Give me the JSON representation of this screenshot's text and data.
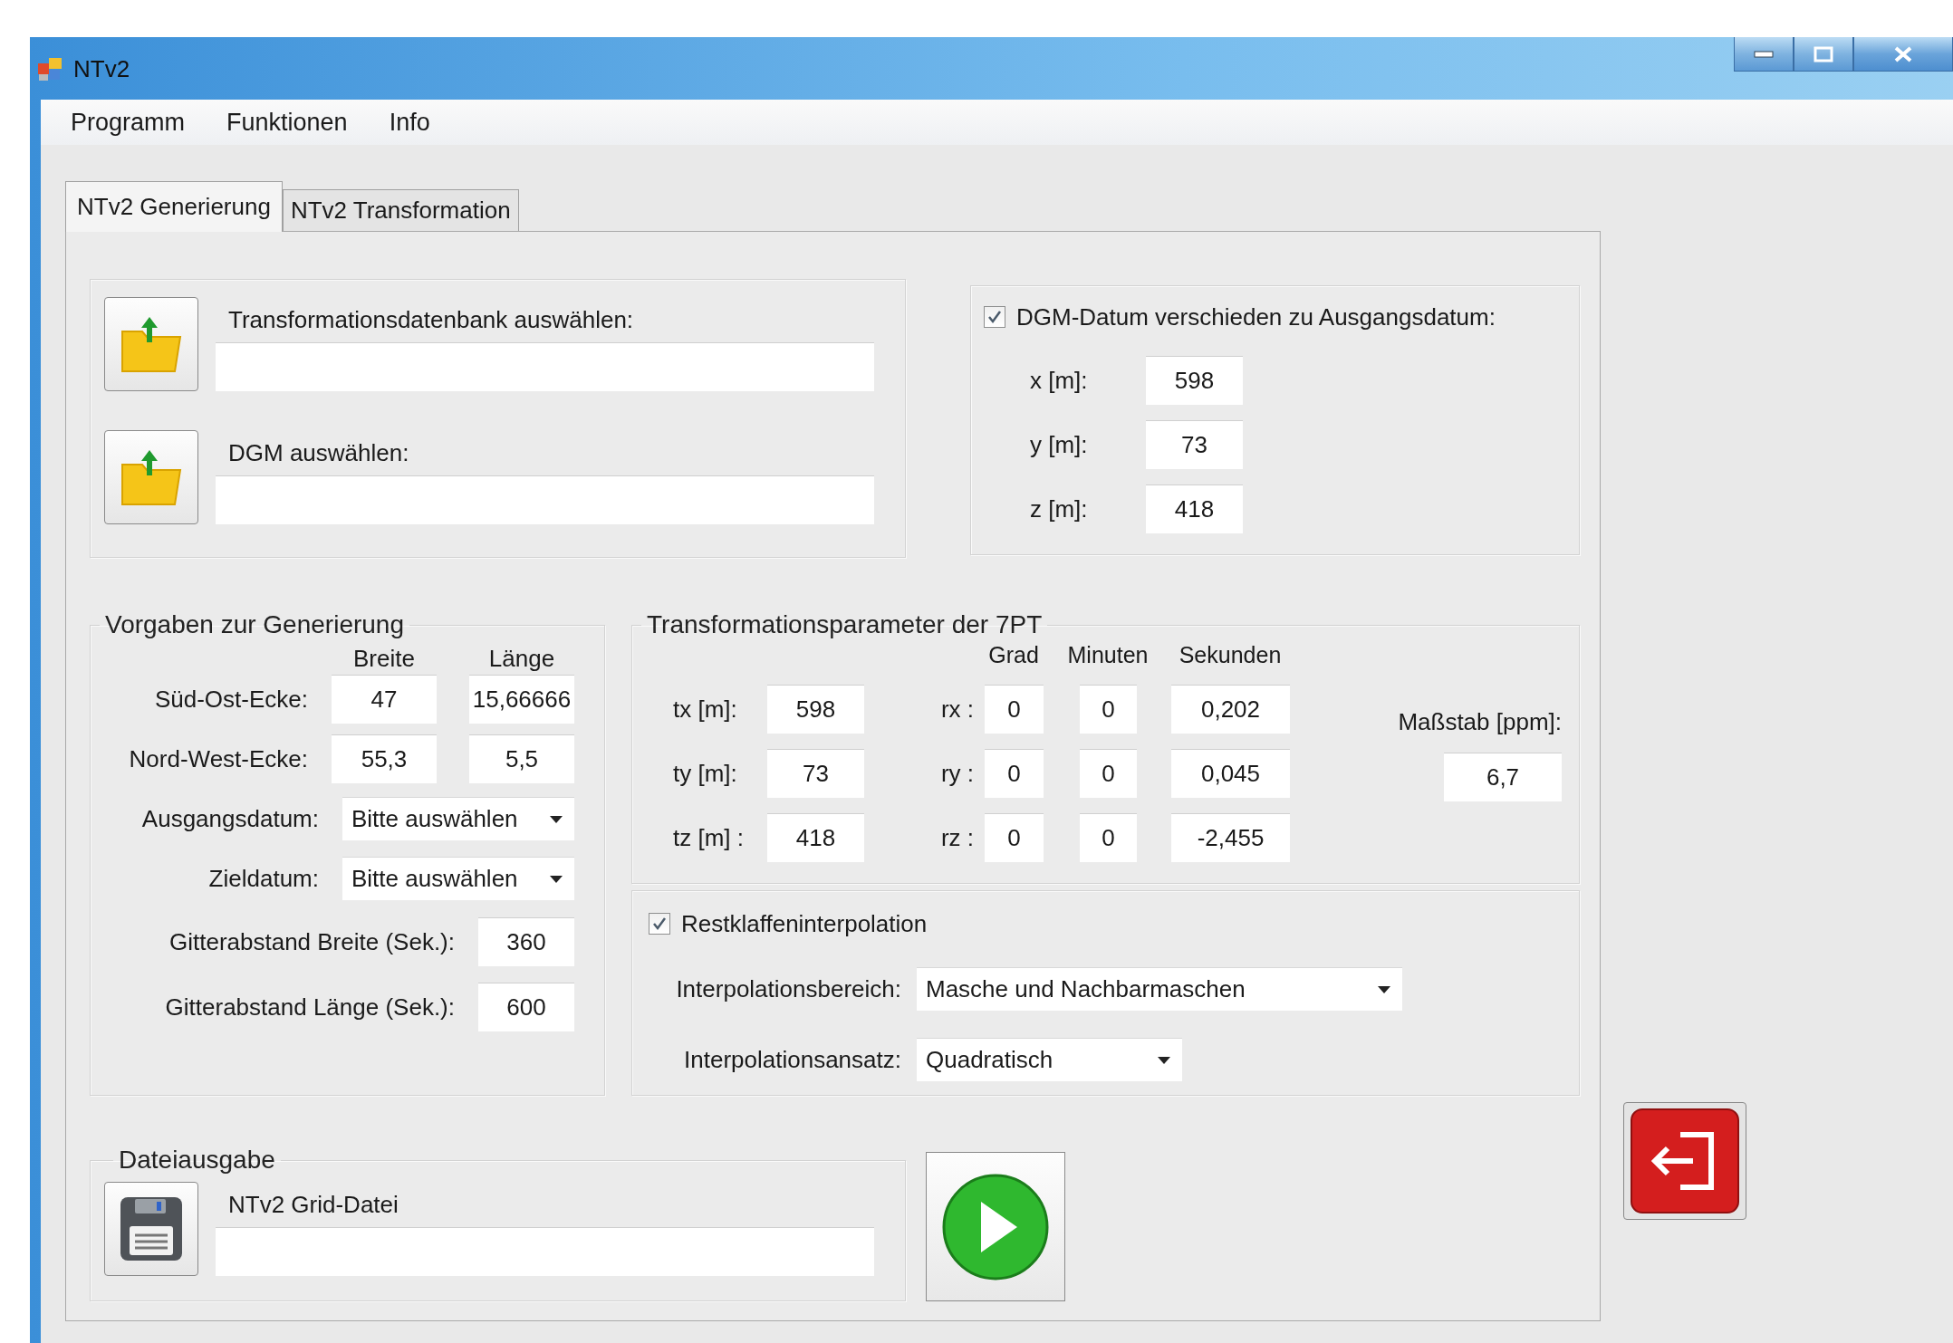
{
  "window": {
    "title": "NTv2"
  },
  "menu": [
    "Programm",
    "Funktionen",
    "Info"
  ],
  "tabs": [
    {
      "label": "NTv2 Generierung",
      "selected": true
    },
    {
      "label": "NTv2 Transformation",
      "selected": false
    }
  ],
  "file_inputs": [
    {
      "label": "Transformationsdatenbank auswählen:"
    },
    {
      "label": "DGM auswählen:"
    }
  ],
  "dgm_offset": {
    "label": "DGM-Datum verschieden zu Ausgangsdatum:",
    "checked": true,
    "fields": [
      {
        "label": "x [m]:",
        "value": "598"
      },
      {
        "label": "y [m]:",
        "value": "73"
      },
      {
        "label": "z [m]:",
        "value": "418"
      }
    ]
  },
  "defaults": {
    "title": "Vorgaben zur Generierung",
    "columns": [
      "Breite",
      "Länge"
    ],
    "corners": [
      {
        "label": "Süd-Ost-Ecke:",
        "values": [
          "47",
          "15,66666"
        ]
      },
      {
        "label": "Nord-West-Ecke:",
        "values": [
          "55,3",
          "5,5"
        ]
      }
    ],
    "datums": [
      {
        "label": "Ausgangsdatum:",
        "value": "Bitte auswählen"
      },
      {
        "label": "Zieldatum:",
        "value": "Bitte auswählen"
      }
    ],
    "grid_spacing": [
      {
        "label": "Gitterabstand Breite (Sek.):",
        "value": "360"
      },
      {
        "label": "Gitterabstand Länge (Sek.):",
        "value": "600"
      }
    ]
  },
  "transformation": {
    "title": "Transformationsparameter der 7PT",
    "columns": [
      "Grad",
      "Minuten",
      "Sekunden"
    ],
    "rows": [
      {
        "t_label": "tx [m]:",
        "t_value": "598",
        "r_label": "rx :",
        "r_values": [
          "0",
          "0",
          "0,202"
        ]
      },
      {
        "t_label": "ty [m]:",
        "t_value": "73",
        "r_label": "ry :",
        "r_values": [
          "0",
          "0",
          "0,045"
        ]
      },
      {
        "t_label": "tz [m] :",
        "t_value": "418",
        "r_label": "rz :",
        "r_values": [
          "0",
          "0",
          "-2,455"
        ]
      }
    ],
    "scale": {
      "label": "Maßstab [ppm]:",
      "value": "6,7"
    }
  },
  "interpolation": {
    "label": "Restklaffeninterpolation",
    "checked": true,
    "range": {
      "label": "Interpolationsbereich:",
      "value": "Masche und Nachbarmaschen"
    },
    "approach": {
      "label": "Interpolationsansatz:",
      "value": "Quadratisch"
    }
  },
  "output": {
    "title": "Dateiausgabe",
    "label": "NTv2 Grid-Datei"
  }
}
